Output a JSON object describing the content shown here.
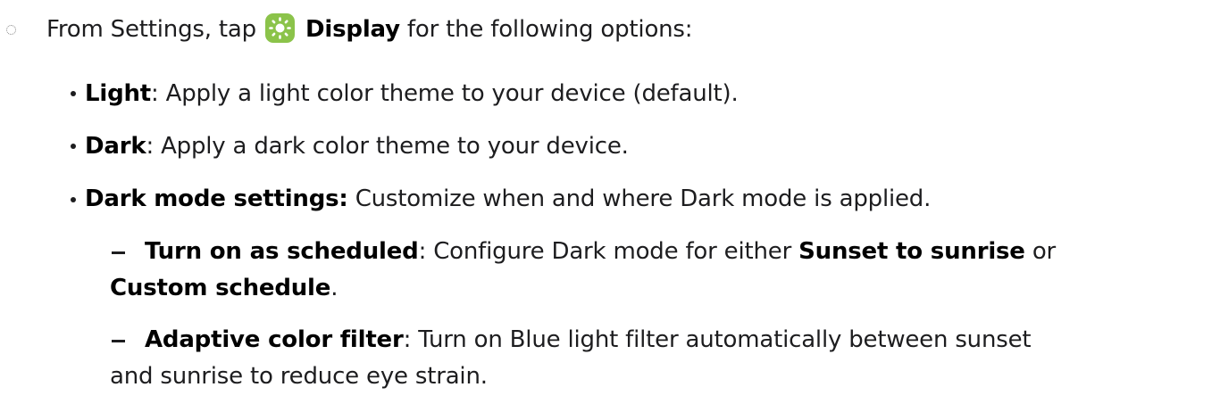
{
  "step": {
    "prefix": "From Settings, tap",
    "settings_item": "Display",
    "suffix": "for the following options:",
    "icon": "display-sun-icon",
    "icon_color": "#8bc34a"
  },
  "options": [
    {
      "term": "Light",
      "desc": ": Apply a light color theme to your device (default)."
    },
    {
      "term": "Dark",
      "desc": ": Apply a dark color theme to your device."
    },
    {
      "term": "Dark mode settings:",
      "desc": " Customize when and where Dark mode is applied."
    }
  ],
  "sub_options": {
    "scheduled": {
      "term": "Turn on as scheduled",
      "desc": ": Configure Dark mode for either ",
      "choice_1": "Sunset to sunrise",
      "joiner": " or",
      "choice_2": "Custom schedule",
      "end": "."
    },
    "adaptive": {
      "term": "Adaptive color filter",
      "desc_line1": ": Turn on Blue light filter automatically between sunset",
      "desc_line2": "and sunrise to reduce eye strain."
    }
  }
}
